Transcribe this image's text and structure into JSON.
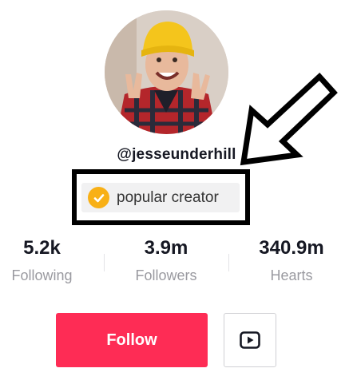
{
  "profile": {
    "username": "@jesseunderhill",
    "badge_label": "popular creator",
    "badge_icon": "check-icon"
  },
  "stats": [
    {
      "value": "5.2k",
      "label": "Following"
    },
    {
      "value": "3.9m",
      "label": "Followers"
    },
    {
      "value": "340.9m",
      "label": "Hearts"
    }
  ],
  "actions": {
    "follow_label": "Follow",
    "youtube_icon": "youtube-icon"
  },
  "colors": {
    "follow_button": "#fe2c55",
    "badge_check": "#f8b016",
    "stat_label": "#9a9aa0"
  }
}
